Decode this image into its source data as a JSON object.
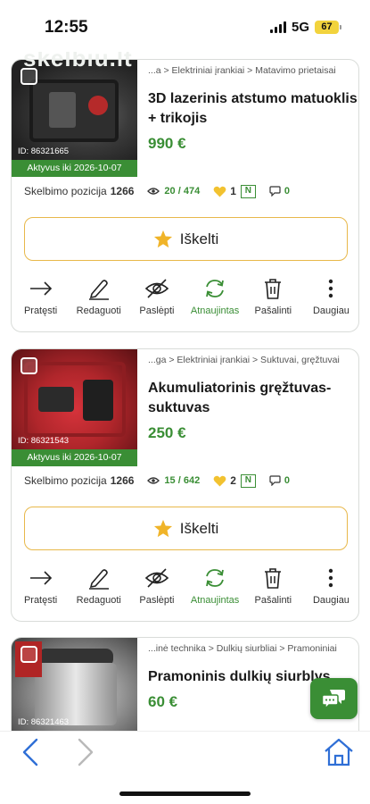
{
  "status_bar": {
    "time": "12:55",
    "network": "5G",
    "battery": "67"
  },
  "watermark": "skelbiu.lt",
  "listings": [
    {
      "id_label": "ID: 86321665",
      "active_until": "Aktyvus iki 2026-10-07",
      "breadcrumb": "...a > Elektriniai įrankiai > Matavimo prietaisai",
      "title": "3D lazerinis atstumo matuoklis + trikojis",
      "price": "990 €",
      "position_label": "Skelbimo pozicija",
      "position_value": "1266",
      "views_current": "20",
      "views_total": "474",
      "likes": "1",
      "new_badge": "N",
      "comments": "0",
      "promote_label": "Iškelti",
      "actions": {
        "extend": "Pratęsti",
        "edit": "Redaguoti",
        "hide": "Paslėpti",
        "renewed": "Atnaujintas",
        "delete": "Pašalinti",
        "more": "Daugiau"
      }
    },
    {
      "id_label": "ID: 86321543",
      "active_until": "Aktyvus iki 2026-10-07",
      "breadcrumb": "...ga > Elektriniai įrankiai > Suktuvai, gręžtuvai",
      "title": "Akumuliatorinis gręžtuvas-suktuvas",
      "price": "250 €",
      "position_label": "Skelbimo pozicija",
      "position_value": "1266",
      "views_current": "15",
      "views_total": "642",
      "likes": "2",
      "new_badge": "N",
      "comments": "0",
      "promote_label": "Iškelti",
      "actions": {
        "extend": "Pratęsti",
        "edit": "Redaguoti",
        "hide": "Paslėpti",
        "renewed": "Atnaujintas",
        "delete": "Pašalinti",
        "more": "Daugiau"
      }
    },
    {
      "id_label": "ID: 86321463",
      "breadcrumb": "...inė technika > Dulkių siurbliai > Pramoniniai",
      "title": "Pramoninis dulkių siurblys",
      "price": "60 €"
    }
  ],
  "icons": {
    "extend": "arrow-right-icon",
    "edit": "pencil-icon",
    "hide": "eye-slash-icon",
    "renewed": "refresh-icon",
    "delete": "trash-icon",
    "more": "dots-vertical-icon",
    "promote": "star-icon",
    "views": "eye-icon",
    "likes": "heart-icon",
    "comments": "comment-icon",
    "chat": "chat-icon",
    "back": "chevron-left-icon",
    "forward": "chevron-right-icon",
    "home": "home-icon"
  },
  "colors": {
    "brand_green": "#3a8e35",
    "promote_border": "#e8b84a",
    "star": "#f0b429",
    "heart": "#f2c230",
    "link_blue": "#2f6fd6"
  }
}
